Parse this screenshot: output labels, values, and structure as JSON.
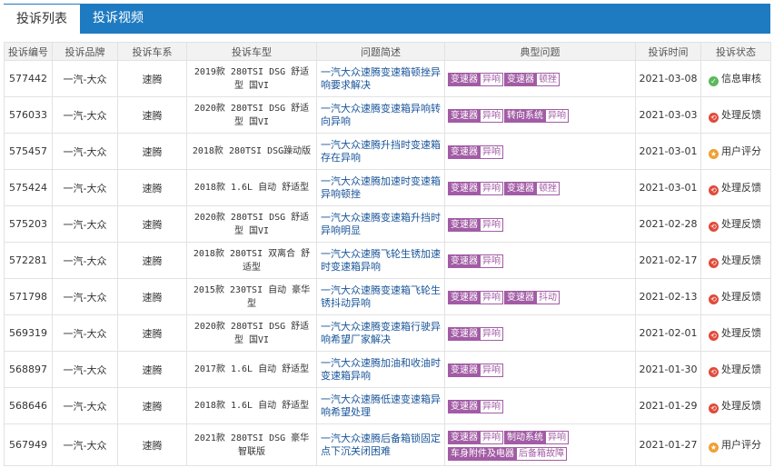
{
  "tabs": [
    {
      "label": "投诉列表",
      "active": true
    },
    {
      "label": "投诉视频",
      "active": false
    }
  ],
  "columns": [
    "投诉编号",
    "投诉品牌",
    "投诉车系",
    "投诉车型",
    "问题简述",
    "典型问题",
    "投诉时间",
    "投诉状态"
  ],
  "rows": [
    {
      "id": "577442",
      "brand": "一汽-大众",
      "series": "速腾",
      "model": "2019款 280TSI DSG 舒适型 国VI",
      "desc": "一汽大众速腾变速箱顿挫异响要求解决",
      "problems": [
        [
          "变速器",
          "异响"
        ],
        [
          "变速器",
          "顿挫"
        ]
      ],
      "date": "2021-03-08",
      "status": "信息审核",
      "status_type": "ok",
      "status_icon": "check-icon"
    },
    {
      "id": "576033",
      "brand": "一汽-大众",
      "series": "速腾",
      "model": "2020款 280TSI DSG 舒适型 国VI",
      "desc": "一汽大众速腾变速箱异响转向异响",
      "problems": [
        [
          "变速器",
          "异响"
        ],
        [
          "转向系统",
          "异响"
        ]
      ],
      "date": "2021-03-03",
      "status": "处理反馈",
      "status_type": "handle",
      "status_icon": "feedback-icon"
    },
    {
      "id": "575457",
      "brand": "一汽-大众",
      "series": "速腾",
      "model": "2018款 280TSI DSG躁动版",
      "desc": "一汽大众速腾升挡时变速箱存在异响",
      "problems": [
        [
          "变速器",
          "异响"
        ]
      ],
      "date": "2021-03-01",
      "status": "用户评分",
      "status_type": "rate",
      "status_icon": "star-icon"
    },
    {
      "id": "575424",
      "brand": "一汽-大众",
      "series": "速腾",
      "model": "2018款 1.6L 自动 舒适型",
      "desc": "一汽大众速腾加速时变速箱异响顿挫",
      "problems": [
        [
          "变速器",
          "异响"
        ],
        [
          "变速器",
          "顿挫"
        ]
      ],
      "date": "2021-03-01",
      "status": "处理反馈",
      "status_type": "handle",
      "status_icon": "feedback-icon"
    },
    {
      "id": "575203",
      "brand": "一汽-大众",
      "series": "速腾",
      "model": "2020款 280TSI DSG 舒适型 国VI",
      "desc": "一汽大众速腾变速箱升挡时异响明显",
      "problems": [
        [
          "变速器",
          "异响"
        ]
      ],
      "date": "2021-02-28",
      "status": "处理反馈",
      "status_type": "handle",
      "status_icon": "feedback-icon"
    },
    {
      "id": "572281",
      "brand": "一汽-大众",
      "series": "速腾",
      "model": "2018款 280TSI 双离合 舒适型",
      "desc": "一汽大众速腾飞轮生锈加速时变速箱异响",
      "problems": [
        [
          "变速器",
          "异响"
        ]
      ],
      "date": "2021-02-17",
      "status": "处理反馈",
      "status_type": "handle",
      "status_icon": "feedback-icon"
    },
    {
      "id": "571798",
      "brand": "一汽-大众",
      "series": "速腾",
      "model": "2015款 230TSI 自动 豪华型",
      "desc": "一汽大众速腾变速箱飞轮生锈抖动异响",
      "problems": [
        [
          "变速器",
          "异响"
        ],
        [
          "变速器",
          "抖动"
        ]
      ],
      "date": "2021-02-13",
      "status": "处理反馈",
      "status_type": "handle",
      "status_icon": "feedback-icon"
    },
    {
      "id": "569319",
      "brand": "一汽-大众",
      "series": "速腾",
      "model": "2020款 280TSI DSG 舒适型 国VI",
      "desc": "一汽大众速腾变速箱行驶异响希望厂家解决",
      "problems": [
        [
          "变速器",
          "异响"
        ]
      ],
      "date": "2021-02-01",
      "status": "处理反馈",
      "status_type": "handle",
      "status_icon": "feedback-icon"
    },
    {
      "id": "568897",
      "brand": "一汽-大众",
      "series": "速腾",
      "model": "2017款 1.6L 自动 舒适型",
      "desc": "一汽大众速腾加油和收油时变速箱异响",
      "problems": [
        [
          "变速器",
          "异响"
        ]
      ],
      "date": "2021-01-30",
      "status": "处理反馈",
      "status_type": "handle",
      "status_icon": "feedback-icon"
    },
    {
      "id": "568646",
      "brand": "一汽-大众",
      "series": "速腾",
      "model": "2018款 1.6L 自动 舒适型",
      "desc": "一汽大众速腾低速变速箱异响希望处理",
      "problems": [
        [
          "变速器",
          "异响"
        ]
      ],
      "date": "2021-01-29",
      "status": "处理反馈",
      "status_type": "handle",
      "status_icon": "feedback-icon"
    },
    {
      "id": "567949",
      "brand": "一汽-大众",
      "series": "速腾",
      "model": "2021款 280TSI DSG 豪华智联版",
      "desc": "一汽大众速腾后备箱锁固定点下沉关闭困难",
      "problems": [
        [
          "变速器",
          "异响"
        ],
        [
          "制动系统",
          "异响"
        ],
        [
          "车身附件及电器",
          "后备箱故障"
        ]
      ],
      "date": "2021-01-27",
      "status": "用户评分",
      "status_type": "rate",
      "status_icon": "star-icon"
    }
  ]
}
